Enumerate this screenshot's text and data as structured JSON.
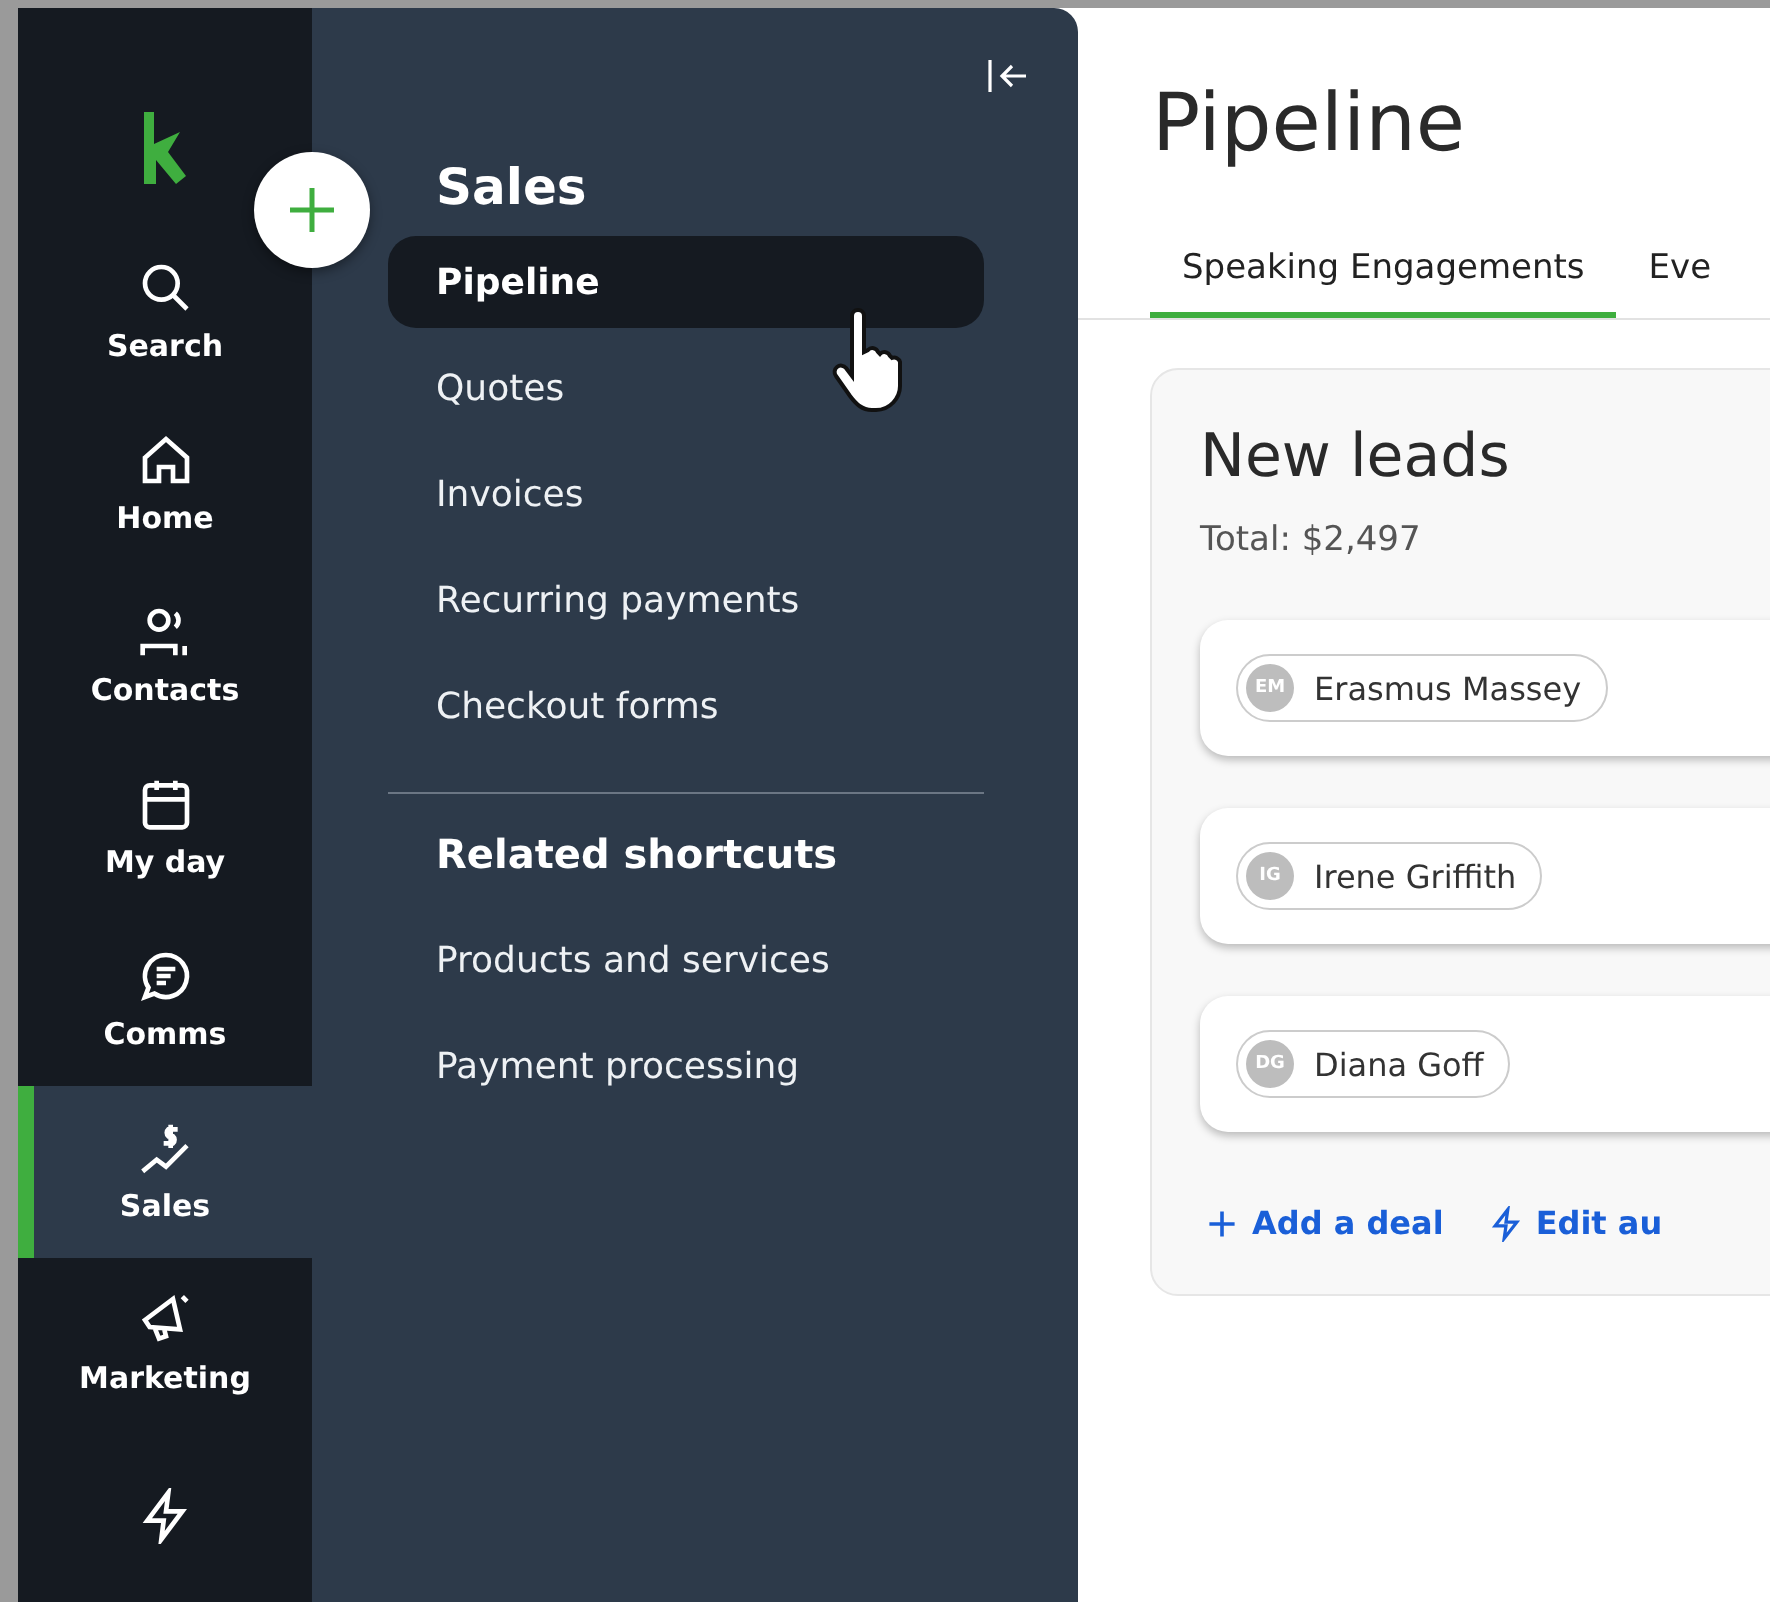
{
  "rail": {
    "items": [
      {
        "label": "Search",
        "selected": false
      },
      {
        "label": "Home",
        "selected": false
      },
      {
        "label": "Contacts",
        "selected": false
      },
      {
        "label": "My day",
        "selected": false
      },
      {
        "label": "Comms",
        "selected": false
      },
      {
        "label": "Sales",
        "selected": true
      },
      {
        "label": "Marketing",
        "selected": false
      },
      {
        "selected": false
      }
    ]
  },
  "panel": {
    "title": "Sales",
    "items": [
      {
        "label": "Pipeline",
        "selected": true
      },
      {
        "label": "Quotes",
        "selected": false
      },
      {
        "label": "Invoices",
        "selected": false
      },
      {
        "label": "Recurring payments",
        "selected": false
      },
      {
        "label": "Checkout forms",
        "selected": false
      }
    ],
    "shortcuts_title": "Related shortcuts",
    "shortcuts": [
      "Products and services",
      "Payment processing"
    ]
  },
  "main": {
    "title": "Pipeline",
    "tabs": [
      {
        "label": "Speaking Engagements",
        "selected": true
      },
      {
        "label": "Eve",
        "selected": false
      }
    ],
    "stage": {
      "title": "New leads",
      "total": "Total: $2,497",
      "deals": [
        {
          "initials": "EM",
          "name": "Erasmus Massey"
        },
        {
          "initials": "IG",
          "name": "Irene Griffith"
        },
        {
          "initials": "DG",
          "name": "Diana Goff"
        }
      ],
      "actions": [
        {
          "kind": "add",
          "label": "Add a deal"
        },
        {
          "kind": "automation",
          "label": "Edit au"
        }
      ]
    }
  }
}
